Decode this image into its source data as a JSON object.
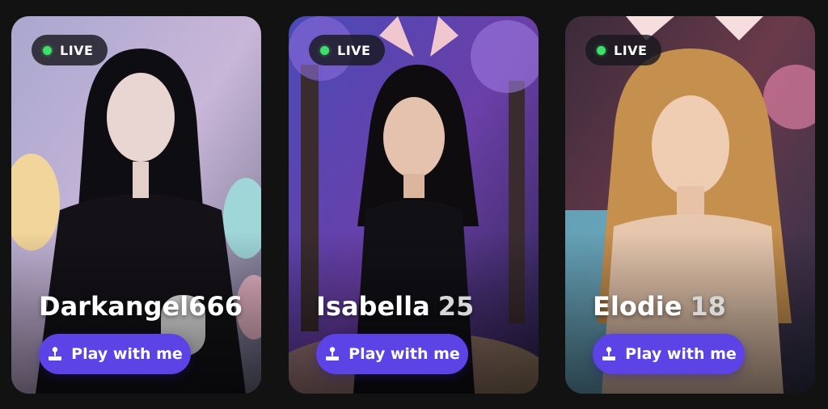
{
  "cards": [
    {
      "status": "LIVE",
      "name": "Darkangel666",
      "age": "",
      "button_label": "Play with me",
      "button_icon": "joystick-icon",
      "colors": {
        "bg": "#2b2f3a",
        "accent": "#5b43e6"
      }
    },
    {
      "status": "LIVE",
      "name": "Isabella",
      "age": "25",
      "button_label": "Play with me",
      "button_icon": "joystick-icon",
      "colors": {
        "bg": "#3a2a6a",
        "accent": "#5b43e6"
      }
    },
    {
      "status": "LIVE",
      "name": "Elodie",
      "age": "18",
      "button_label": "Play with me",
      "button_icon": "joystick-icon",
      "colors": {
        "bg": "#3a2a3a",
        "accent": "#5b43e6"
      }
    }
  ],
  "live_dot_color": "#3ee06a"
}
